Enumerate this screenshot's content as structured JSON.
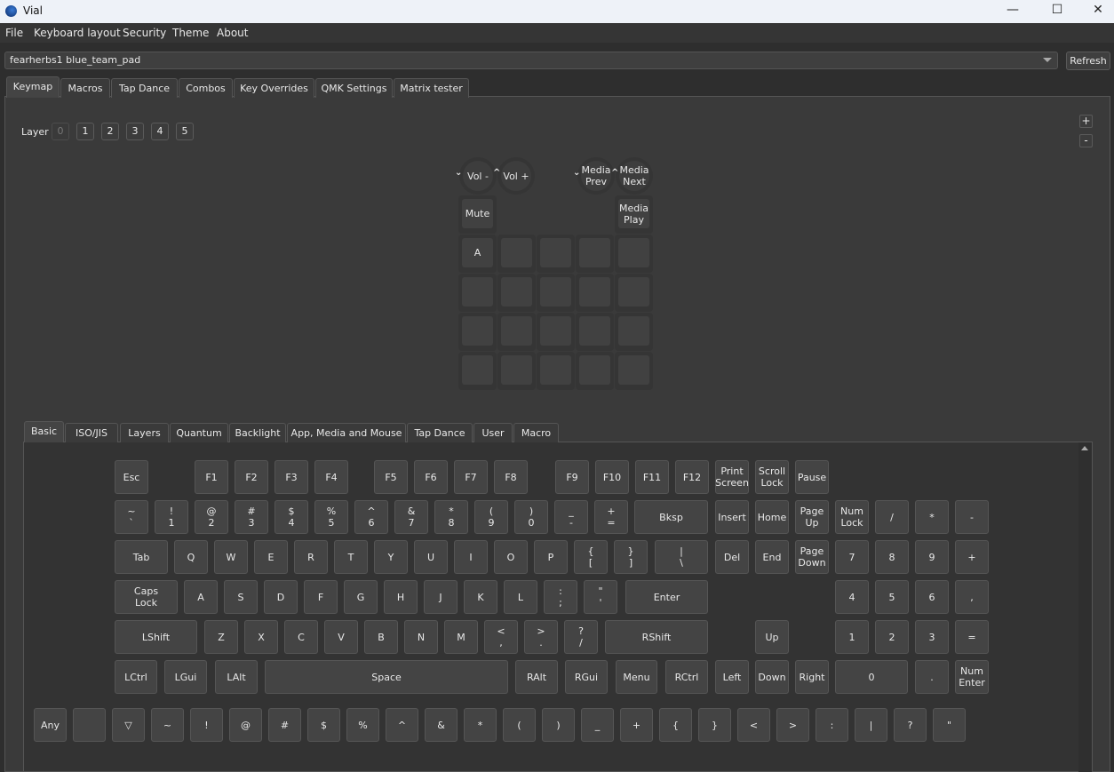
{
  "window": {
    "title": "Vial",
    "controls": [
      "—",
      "☐",
      "✕"
    ]
  },
  "menu": [
    "File",
    "Keyboard layout",
    "Security",
    "Theme",
    "About"
  ],
  "device": {
    "selected": "fearherbs1 blue_team_pad",
    "refresh": "Refresh"
  },
  "main_tabs": [
    "Keymap",
    "Macros",
    "Tap Dance",
    "Combos",
    "Key Overrides",
    "QMK Settings",
    "Matrix tester"
  ],
  "main_tab_active": "Keymap",
  "layer": {
    "label": "Layer",
    "buttons": [
      "0",
      "1",
      "2",
      "3",
      "4",
      "5"
    ],
    "selected": "0"
  },
  "zoom": {
    "plus": "+",
    "minus": "-"
  },
  "pad": {
    "encoders": [
      {
        "label": "Vol -",
        "arrow": "⌄"
      },
      {
        "label": "Vol +",
        "arrow": "^"
      },
      {
        "label": "Media\nPrev",
        "arrow": "⌄"
      },
      {
        "label": "Media\nNext",
        "arrow": "^"
      }
    ],
    "top_keys": [
      "Mute",
      "Media\nPlay"
    ],
    "grid": [
      [
        "A",
        "",
        "",
        "",
        ""
      ],
      [
        "",
        "",
        "",
        "",
        ""
      ],
      [
        "",
        "",
        "",
        "",
        ""
      ],
      [
        "",
        "",
        "",
        "",
        ""
      ]
    ]
  },
  "keycode_tabs": [
    "Basic",
    "ISO/JIS",
    "Layers",
    "Quantum",
    "Backlight",
    "App, Media and Mouse",
    "Tap Dance",
    "User",
    "Macro"
  ],
  "keycode_tab_active": "Basic",
  "keyboard": {
    "rows": [
      [
        "Esc",
        "F1",
        "F2",
        "F3",
        "F4",
        "F5",
        "F6",
        "F7",
        "F8",
        "F9",
        "F10",
        "F11",
        "F12",
        "Print\nScreen",
        "Scroll\nLock",
        "Pause"
      ],
      [
        "~\n`",
        "!\n1",
        "@\n2",
        "#\n3",
        "$\n4",
        "%\n5",
        "^\n6",
        "&\n7",
        "*\n8",
        "(\n9",
        ")\n0",
        "_\n-",
        "+\n=",
        "Bksp",
        "Insert",
        "Home",
        "Page\nUp",
        "Num\nLock",
        "/",
        "*",
        "-"
      ],
      [
        "Tab",
        "Q",
        "W",
        "E",
        "R",
        "T",
        "Y",
        "U",
        "I",
        "O",
        "P",
        "{\n[",
        "}\n]",
        "|\n\\",
        "Del",
        "End",
        "Page\nDown",
        "7",
        "8",
        "9",
        "+"
      ],
      [
        "Caps\nLock",
        "A",
        "S",
        "D",
        "F",
        "G",
        "H",
        "J",
        "K",
        "L",
        ":\n;",
        "\"\n'",
        "Enter",
        "4",
        "5",
        "6",
        ","
      ],
      [
        "LShift",
        "Z",
        "X",
        "C",
        "V",
        "B",
        "N",
        "M",
        "<\n,",
        ">\n.",
        "?\n/",
        "RShift",
        "Up",
        "1",
        "2",
        "3",
        "="
      ],
      [
        "LCtrl",
        "LGui",
        "LAlt",
        "Space",
        "RAlt",
        "RGui",
        "Menu",
        "RCtrl",
        "Left",
        "Down",
        "Right",
        "0",
        ".",
        "Num\nEnter"
      ]
    ],
    "extra_row": [
      "Any",
      "",
      "▽",
      "~",
      "!",
      "@",
      "#",
      "$",
      "%",
      "^",
      "&",
      "*",
      "(",
      ")",
      "_",
      "+",
      "{",
      "}",
      "<",
      ">",
      ":",
      "|",
      "?",
      "\""
    ]
  }
}
